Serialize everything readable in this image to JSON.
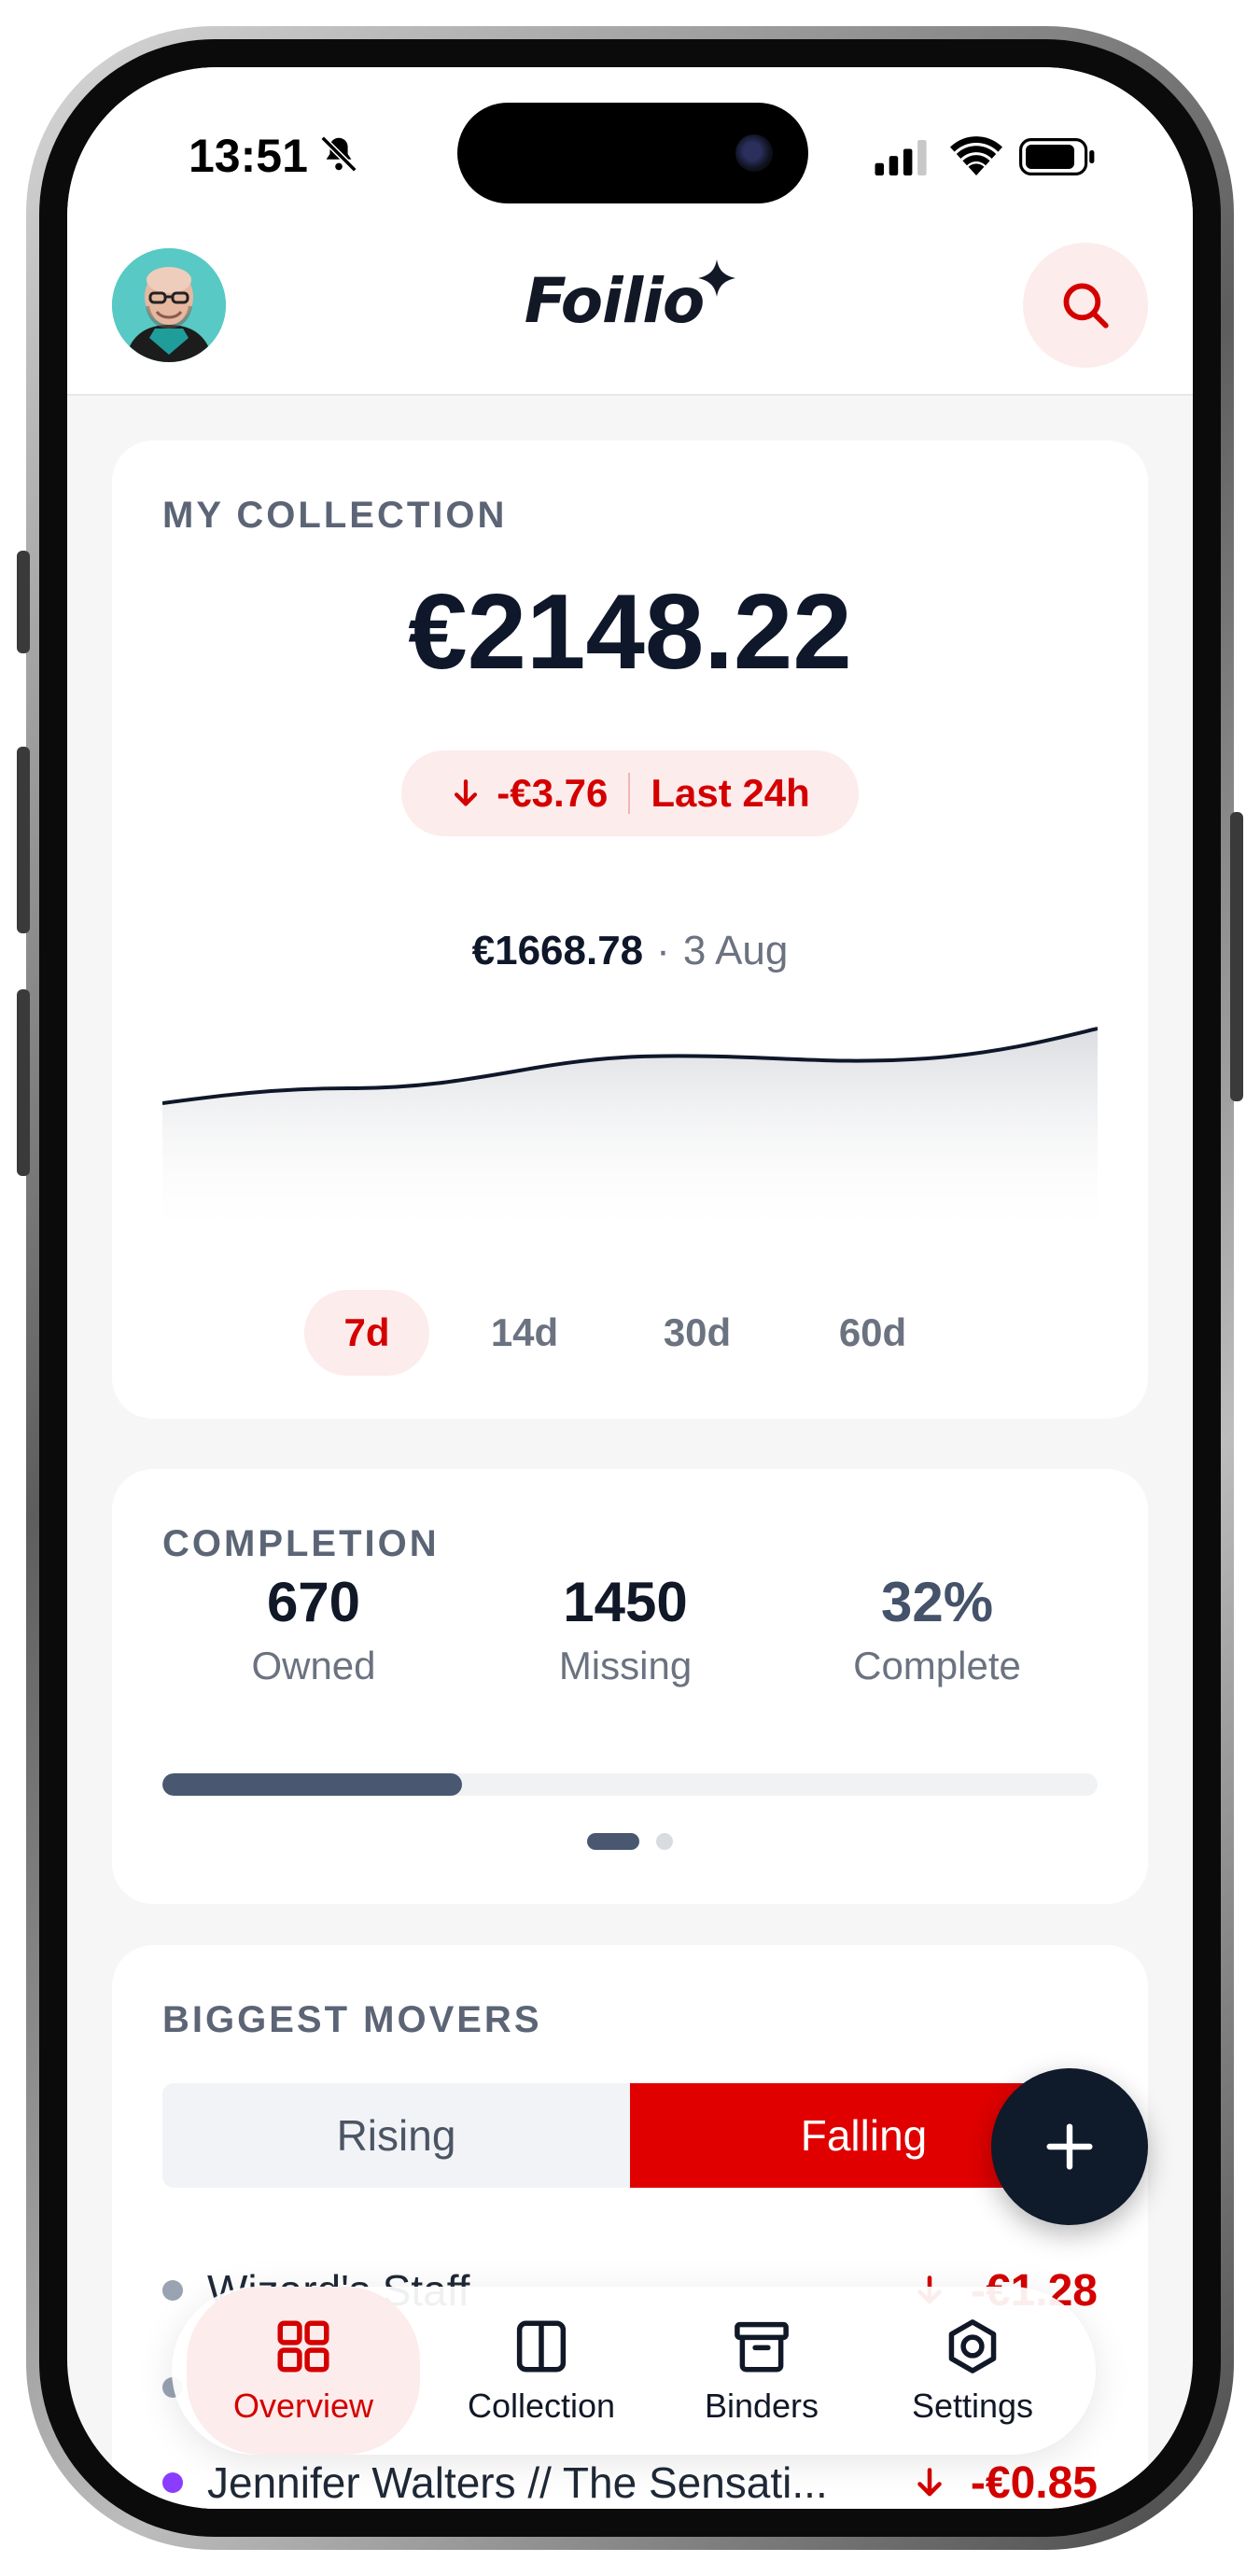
{
  "status_bar": {
    "time": "13:51"
  },
  "header": {
    "logo": "Foilio"
  },
  "collection": {
    "label": "MY COLLECTION",
    "total": "€2148.22",
    "change": "-€3.76",
    "change_period": "Last 24h",
    "readout_value": "€1668.78",
    "readout_date": "3 Aug",
    "ranges": [
      "7d",
      "14d",
      "30d",
      "60d"
    ],
    "active_range": "7d"
  },
  "completion": {
    "label": "COMPLETION",
    "owned": "670",
    "owned_label": "Owned",
    "missing": "1450",
    "missing_label": "Missing",
    "complete": "32%",
    "complete_label": "Complete",
    "progress_fraction": 0.32
  },
  "movers": {
    "label": "BIGGEST MOVERS",
    "tabs": [
      "Rising",
      "Falling"
    ],
    "active_tab": "Falling",
    "items": [
      {
        "name": "Wizard's Staff",
        "change": "-€1.28",
        "bullet_color": "#9aa3b2"
      },
      {
        "name": "",
        "change": "",
        "bullet_color": "#9aa3b2"
      },
      {
        "name": "Jennifer Walters // The Sensati...",
        "change": "-€0.85",
        "bullet_color": "#8b3dff"
      }
    ]
  },
  "tab_bar": {
    "items": [
      {
        "label": "Overview",
        "icon": "grid-icon",
        "active": true
      },
      {
        "label": "Collection",
        "icon": "columns-icon",
        "active": false
      },
      {
        "label": "Binders",
        "icon": "archive-icon",
        "active": false
      },
      {
        "label": "Settings",
        "icon": "hexagon-gear-icon",
        "active": false
      }
    ]
  },
  "colors": {
    "accent": "#d40000",
    "accent_bg": "#fdecec",
    "dark": "#0f1a2b",
    "slate": "#495870"
  }
}
